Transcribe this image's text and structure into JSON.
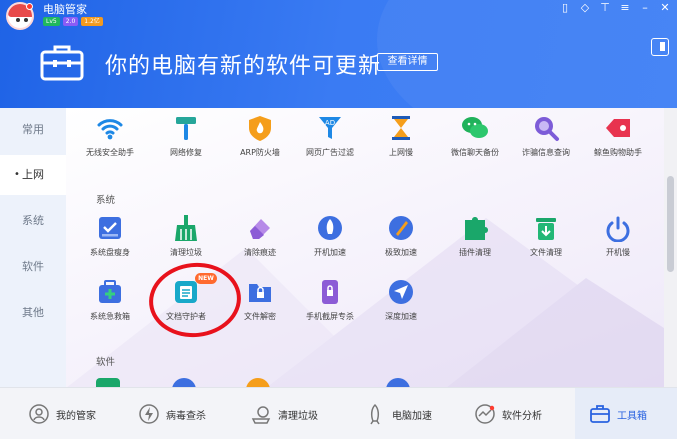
{
  "app": {
    "title": "电脑管家",
    "badges": [
      "Lv5",
      "2.0",
      "1.2亿"
    ]
  },
  "window_controls": [
    "phone-icon",
    "shield-icon",
    "shirt-icon",
    "menu-icon",
    "minimize-icon",
    "close-icon"
  ],
  "banner": {
    "text": "你的电脑有新的软件可更新",
    "detail_button": "查看详情"
  },
  "leftnav": {
    "items": [
      "常用",
      "上网",
      "系统",
      "软件",
      "其他"
    ],
    "active_index": 1
  },
  "sections": {
    "system": "系统",
    "software": "软件"
  },
  "tools": {
    "internet": [
      {
        "label": "无线安全助手",
        "icon": "wifi-icon"
      },
      {
        "label": "网络修复",
        "icon": "hammer-icon"
      },
      {
        "label": "ARP防火墙",
        "icon": "fire-shield-icon"
      },
      {
        "label": "网页广告过滤",
        "icon": "ad-filter-icon"
      },
      {
        "label": "上网慢",
        "icon": "hourglass-icon"
      },
      {
        "label": "微信聊天备份",
        "icon": "wechat-icon"
      },
      {
        "label": "诈骗信息查询",
        "icon": "magnifier-icon"
      },
      {
        "label": "鲸鱼购物助手",
        "icon": "tag-icon"
      }
    ],
    "system": [
      {
        "label": "系统盘瘦身",
        "icon": "disk-icon"
      },
      {
        "label": "清理垃圾",
        "icon": "broom-icon"
      },
      {
        "label": "清除痕迹",
        "icon": "eraser-icon"
      },
      {
        "label": "开机加速",
        "icon": "rocket-icon"
      },
      {
        "label": "极致加速",
        "icon": "speed-pen-icon"
      },
      {
        "label": "插件清理",
        "icon": "puzzle-icon"
      },
      {
        "label": "文件清理",
        "icon": "trash-icon"
      },
      {
        "label": "开机慢",
        "icon": "power-icon"
      },
      {
        "label": "系统急救箱",
        "icon": "first-aid-icon"
      },
      {
        "label": "文档守护者",
        "icon": "document-icon",
        "badge": "NEW"
      },
      {
        "label": "文件解密",
        "icon": "folder-lock-icon"
      },
      {
        "label": "手机截屏专杀",
        "icon": "phone-lock-icon"
      },
      {
        "label": "深度加速",
        "icon": "paper-plane-icon"
      }
    ]
  },
  "bottombar": {
    "items": [
      {
        "label": "我的管家",
        "icon": "home-icon"
      },
      {
        "label": "病毒查杀",
        "icon": "virus-icon"
      },
      {
        "label": "清理垃圾",
        "icon": "clean-icon"
      },
      {
        "label": "电脑加速",
        "icon": "rocket-icon"
      },
      {
        "label": "软件分析",
        "icon": "analysis-icon"
      },
      {
        "label": "工具箱",
        "icon": "toolbox-icon"
      }
    ],
    "active_index": 5
  },
  "colors": {
    "header": "#2f6ff0",
    "accent": "#2a63e0",
    "annotation_ring": "#e8121c"
  }
}
